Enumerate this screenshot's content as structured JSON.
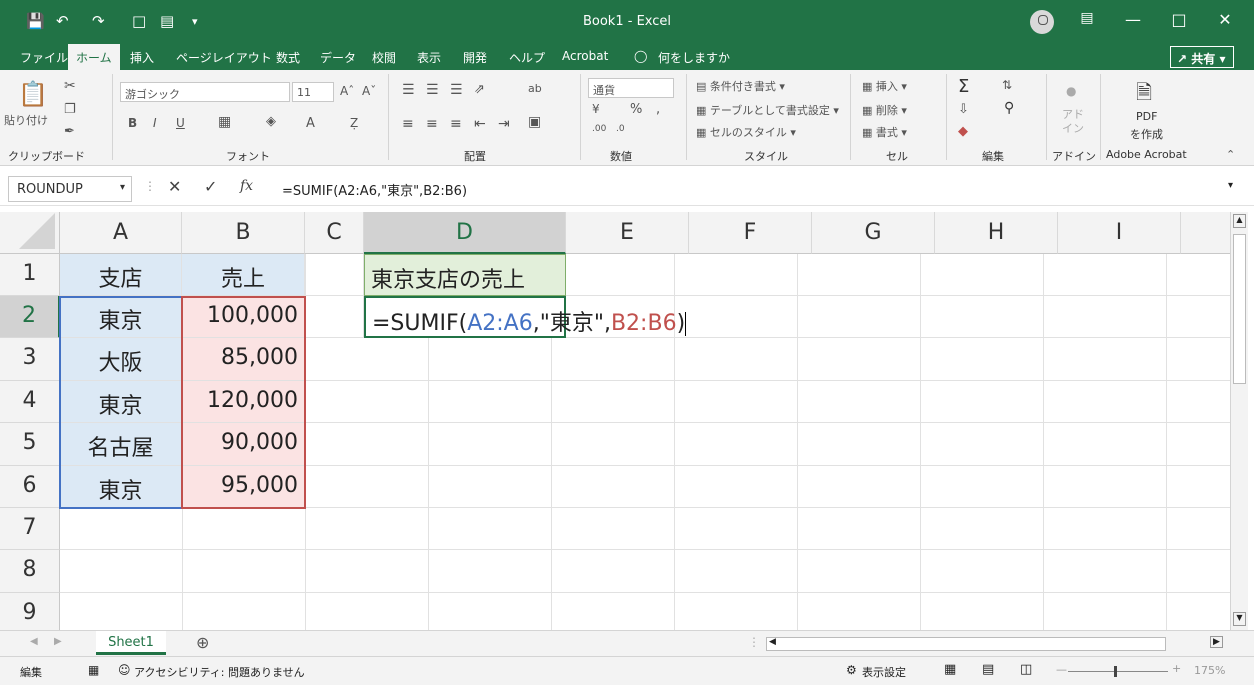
{
  "titlebar": {
    "title": "Book1 - Excel",
    "quick_access": [
      "save-icon",
      "undo-icon",
      "redo-icon",
      "new-file-icon",
      "form-icon",
      "customize-icon"
    ]
  },
  "menu": {
    "tabs": [
      "ファイル",
      "ホーム",
      "挿入",
      "ページレイアウト",
      "数式",
      "データ",
      "校閲",
      "表示",
      "開発",
      "ヘルプ",
      "Acrobat",
      "何をしますか"
    ],
    "active": "ホーム",
    "share": "共有"
  },
  "ribbon": {
    "clipboard": {
      "paste": "貼り付け",
      "label": "クリップボード"
    },
    "font": {
      "name": "游ゴシック",
      "size": "11",
      "label": "フォント"
    },
    "align": {
      "label": "配置"
    },
    "number": {
      "format": "通貨",
      "label": "数値"
    },
    "style": {
      "cond": "条件付き書式",
      "table": "テーブルとして書式設定",
      "cell": "セルのスタイル",
      "label": "スタイル"
    },
    "cells": {
      "insert": "挿入",
      "delete": "削除",
      "format": "書式",
      "label": "セル"
    },
    "edit": {
      "label": "編集"
    },
    "addin": {
      "name": "アド\nイン",
      "label": "アドイン"
    },
    "acrobat": {
      "pdf": "PDF",
      "create": "を作成",
      "label": "Adobe Acrobat"
    }
  },
  "formula_bar": {
    "name_box": "ROUNDUP",
    "formula": "=SUMIF(A2:A6,\"東京\",B2:B6)"
  },
  "grid": {
    "columns": [
      "A",
      "B",
      "C",
      "D",
      "E",
      "F",
      "G",
      "H",
      "I"
    ],
    "rows": [
      "1",
      "2",
      "3",
      "4",
      "5",
      "6",
      "7",
      "8",
      "9"
    ],
    "header_a": "支店",
    "header_b": "売上",
    "branches": [
      "東京",
      "大阪",
      "東京",
      "名古屋",
      "東京"
    ],
    "sales": [
      "100,000",
      "85,000",
      "120,000",
      "90,000",
      "95,000"
    ],
    "d1": "東京支店の売上",
    "d2_parts": {
      "prefix": "=SUMIF(",
      "range1": "A2:A6",
      "mid": ",\"東京\",",
      "range2": "B2:B6",
      "suffix": ")"
    }
  },
  "sheet": {
    "tab": "Sheet1"
  },
  "status": {
    "mode": "編集",
    "accessibility": "アクセシビリティ: 問題ありません",
    "display": "表示設定",
    "zoom": "175%"
  },
  "colors": {
    "accent": "#217346",
    "range_blue": "#4472c4",
    "range_red": "#c0504d"
  }
}
